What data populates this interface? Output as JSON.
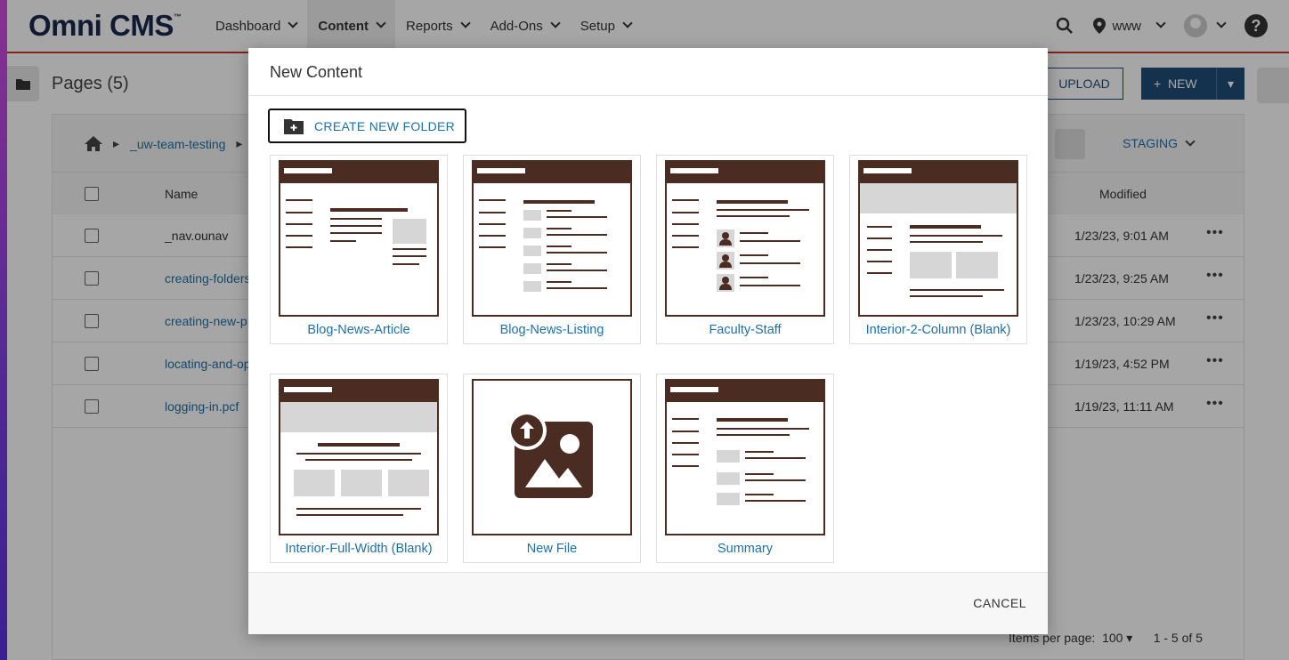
{
  "app": {
    "logo": "Omni CMS",
    "logo_tm": "™"
  },
  "nav": {
    "items": [
      {
        "label": "Dashboard"
      },
      {
        "label": "Content"
      },
      {
        "label": "Reports"
      },
      {
        "label": "Add-Ons"
      },
      {
        "label": "Setup"
      }
    ],
    "site_selector": "www"
  },
  "page": {
    "title": "Pages (5)",
    "upload_label": "UPLOAD",
    "new_label": "NEW",
    "breadcrumb": "_uw-team-testing",
    "staging_label": "STAGING",
    "columns": {
      "name": "Name",
      "modified": "Modified"
    },
    "rows": [
      {
        "name": "_nav.ounav",
        "modified": "1/23/23, 9:01 AM"
      },
      {
        "name": "creating-folders",
        "modified": "1/23/23, 9:25 AM"
      },
      {
        "name": "creating-new-p",
        "modified": "1/23/23, 10:29 AM"
      },
      {
        "name": "locating-and-op",
        "modified": "1/19/23, 4:52 PM"
      },
      {
        "name": "logging-in.pcf",
        "modified": "1/19/23, 11:11 AM"
      }
    ],
    "items_per_page_label": "Items per page:",
    "items_per_page_value": "100",
    "pagination": "1 - 5 of 5"
  },
  "modal": {
    "title": "New Content",
    "create_folder_label": "CREATE NEW FOLDER",
    "cancel_label": "CANCEL",
    "templates": [
      {
        "label": "Blog-News-Article"
      },
      {
        "label": "Blog-News-Listing"
      },
      {
        "label": "Faculty-Staff"
      },
      {
        "label": "Interior-2-Column (Blank)"
      },
      {
        "label": "Interior-Full-Width (Blank)"
      },
      {
        "label": "New File"
      },
      {
        "label": "Summary"
      }
    ]
  },
  "colors": {
    "brand": "#1a2a4f",
    "link": "#1f6fa8",
    "thumb": "#4a2c22",
    "accent_bar": "#c0392b"
  }
}
